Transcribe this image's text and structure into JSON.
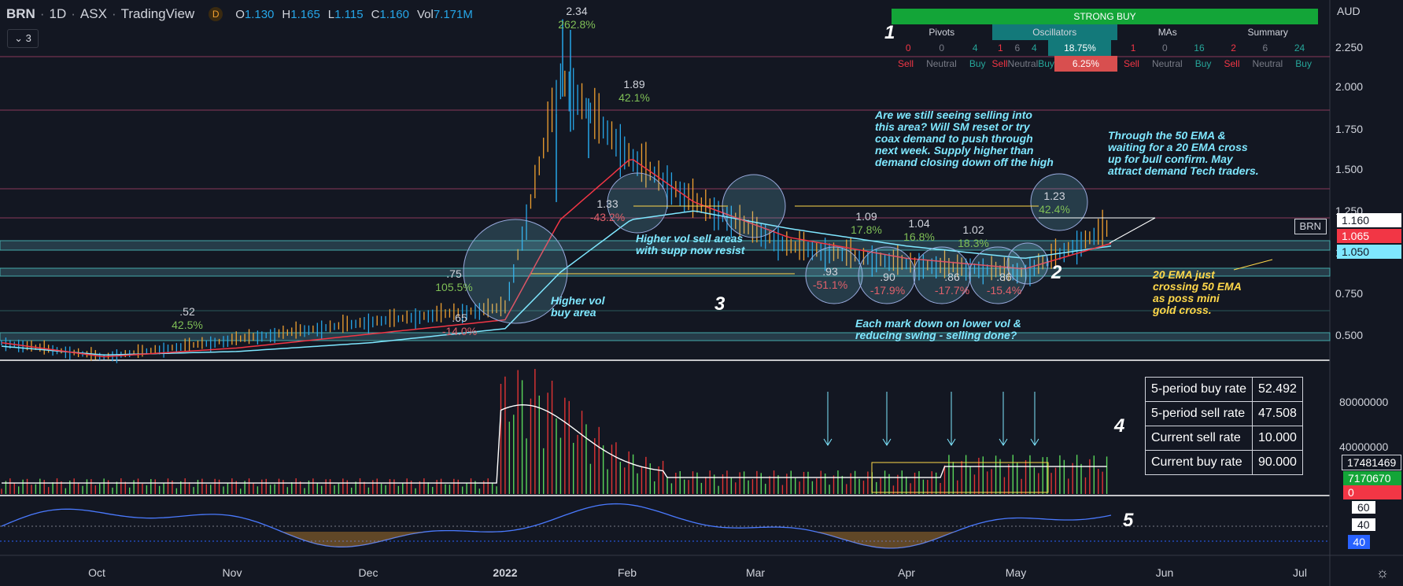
{
  "header": {
    "symbol": "BRN",
    "interval": "1D",
    "exchange": "ASX",
    "platform": "TradingView",
    "badge": "D",
    "o_k": "O",
    "o_v": "1.130",
    "h_k": "H",
    "h_v": "1.165",
    "l_k": "L",
    "l_v": "1.115",
    "c_k": "C",
    "c_v": "1.160",
    "vol_k": "Vol",
    "vol_v": "7.171M",
    "collapse": "3"
  },
  "tech": {
    "banner": "STRONG BUY",
    "cols": [
      {
        "title": "Pivots",
        "nums": [
          "0",
          "0",
          "4"
        ],
        "lbls": [
          "Sell",
          "Neutral",
          "Buy"
        ]
      },
      {
        "title": "Oscillators",
        "nums": [
          "1",
          "6",
          "4"
        ],
        "lbls": [
          "Sell",
          "Neutral",
          "Buy"
        ],
        "pct_head": "75%",
        "pct1": "18.75%",
        "pct2": "6.25%"
      },
      {
        "title": "MAs",
        "nums": [
          "1",
          "0",
          "16"
        ],
        "lbls": [
          "Sell",
          "Neutral",
          "Buy"
        ]
      },
      {
        "title": "Summary",
        "nums": [
          "2",
          "6",
          "24"
        ],
        "lbls": [
          "Sell",
          "Neutral",
          "Buy"
        ]
      }
    ]
  },
  "stats": [
    {
      "label": "5-period buy rate",
      "value": "52.492"
    },
    {
      "label": "5-period sell rate",
      "value": "47.508"
    },
    {
      "label": "Current sell rate",
      "value": "10.000"
    },
    {
      "label": "Current buy rate",
      "value": "90.000"
    }
  ],
  "price_scale": {
    "currency": "AUD",
    "ticks": [
      "2.250",
      "2.000",
      "1.750",
      "1.500",
      "1.250",
      "1.000",
      "0.750",
      "0.500"
    ],
    "tags": [
      {
        "text": "1.160",
        "bg": "#ffffff",
        "fg": "#131722"
      },
      {
        "text": "1.065",
        "bg": "#f23645",
        "fg": "#ffffff"
      },
      {
        "text": "1.050",
        "bg": "#7fe7ff",
        "fg": "#131722"
      }
    ],
    "sym_tag": "BRN"
  },
  "volume_scale": {
    "ticks": [
      "80000000",
      "40000000"
    ],
    "tags": [
      "17481469",
      "7170670",
      "0"
    ]
  },
  "osc_scale": {
    "ticks": [
      "60",
      "40"
    ],
    "tag": "40"
  },
  "x_axis": [
    "Oct",
    "Nov",
    "Dec",
    "2022",
    "Feb",
    "Mar",
    "Apr",
    "May",
    "Jun",
    "Jul"
  ],
  "levels": [
    {
      "a": ".52",
      "b": "42.5%",
      "dir": "up"
    },
    {
      "a": ".75",
      "b": "105.5%",
      "dir": "up"
    },
    {
      "a": ".65",
      "b": "-14.0%",
      "dir": "dn"
    },
    {
      "a": "2.34",
      "b": "262.8%",
      "dir": "up"
    },
    {
      "a": "1.89",
      "b": "42.1%",
      "dir": "up"
    },
    {
      "a": "1.33",
      "b": "-43.2%",
      "dir": "dn"
    },
    {
      "a": ".93",
      "b": "-51.1%",
      "dir": "dn"
    },
    {
      "a": "1.09",
      "b": "17.8%",
      "dir": "up"
    },
    {
      "a": ".90",
      "b": "-17.9%",
      "dir": "dn"
    },
    {
      "a": "1.04",
      "b": "16.8%",
      "dir": "up"
    },
    {
      "a": ".86",
      "b": "-17.7%",
      "dir": "dn"
    },
    {
      "a": "1.02",
      "b": "18.3%",
      "dir": "up"
    },
    {
      "a": ".86",
      "b": "-15.4%",
      "dir": "dn"
    },
    {
      "a": "1.23",
      "b": "42.4%",
      "dir": "up"
    }
  ],
  "notes": [
    {
      "text": "Are we still seeing selling into\nthis area? Will SM reset or try\ncoax demand to push through\nnext week. Supply higher than\ndemand closing down off the high",
      "color": "cyan"
    },
    {
      "text": "Through the 50 EMA &\nwaiting for a 20 EMA cross\nup for bull confirm. May\nattract demand Tech traders.",
      "color": "cyan"
    },
    {
      "text": "Higher vol sell areas\nwith supp now resist",
      "color": "cyan"
    },
    {
      "text": "Higher vol\nbuy area",
      "color": "cyan"
    },
    {
      "text": "Each mark down on lower vol &\nreducing swing - selling done?",
      "color": "cyan"
    },
    {
      "text": "20 EMA just\ncrossing 50 EMA\nas poss mini\ngold cross.",
      "color": "yellow"
    }
  ],
  "marks": [
    "1",
    "2",
    "3",
    "4",
    "5"
  ],
  "chart_data": {
    "type": "candlestick",
    "ylim": [
      0.4,
      2.45
    ],
    "close_series": {
      "x": [
        "Sep",
        "Oct",
        "Nov",
        "Dec",
        "2022",
        "Jan-mid",
        "Feb",
        "Feb-mid",
        "Mar",
        "Apr",
        "May",
        "May-mid"
      ],
      "values": [
        0.5,
        0.42,
        0.52,
        0.62,
        0.7,
        2.0,
        1.55,
        1.3,
        1.05,
        0.95,
        0.9,
        1.16
      ]
    },
    "ema20": [
      0.5,
      0.42,
      0.47,
      0.55,
      0.63,
      1.2,
      1.55,
      1.3,
      1.1,
      0.98,
      0.92,
      1.065
    ],
    "ema50": [
      0.48,
      0.43,
      0.45,
      0.5,
      0.58,
      0.9,
      1.2,
      1.25,
      1.15,
      1.05,
      0.98,
      1.05
    ],
    "volume_peak": 100000000,
    "colors": {
      "up": "#26a6e8",
      "down": "#f0a030",
      "vol_up": "#5ad65a",
      "vol_down": "#e03434",
      "ema20": "#f23645",
      "ema50": "#7fe7ff"
    }
  }
}
